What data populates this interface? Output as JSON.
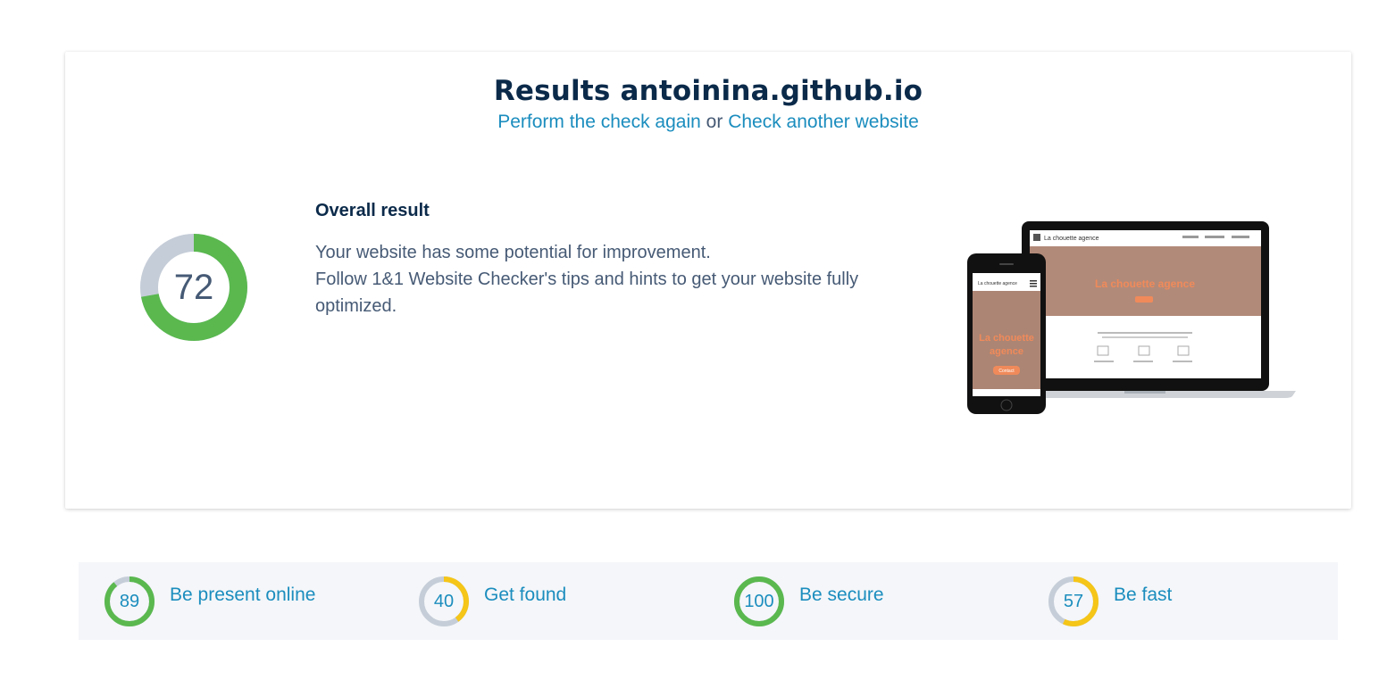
{
  "header": {
    "title": "Results antoinina.github.io",
    "recheck_link": "Perform the check again",
    "separator": "or",
    "another_link": "Check another website"
  },
  "overall": {
    "score": "72",
    "score_value": 72,
    "heading": "Overall result",
    "line1": "Your website has some potential for improvement.",
    "line2": "Follow 1&1 Website Checker's tips and hints to get your website fully optimized."
  },
  "mockup": {
    "laptop_site_title": "La chouette agence",
    "phone_site_title": "La chouette agence",
    "phone_button": "Contact"
  },
  "categories": [
    {
      "score": "89",
      "value": 89,
      "label": "Be present online",
      "color": "#5ab84f"
    },
    {
      "score": "40",
      "value": 40,
      "label": "Get found",
      "color": "#f5c518"
    },
    {
      "score": "100",
      "value": 100,
      "label": "Be secure",
      "color": "#5ab84f"
    },
    {
      "score": "57",
      "value": 57,
      "label": "Be fast",
      "color": "#f5c518"
    }
  ],
  "colors": {
    "good": "#5ab84f",
    "medium": "#f5c518",
    "track": "#c5cdd8",
    "link": "#1b8dbe",
    "heading": "#0b2a4a"
  }
}
